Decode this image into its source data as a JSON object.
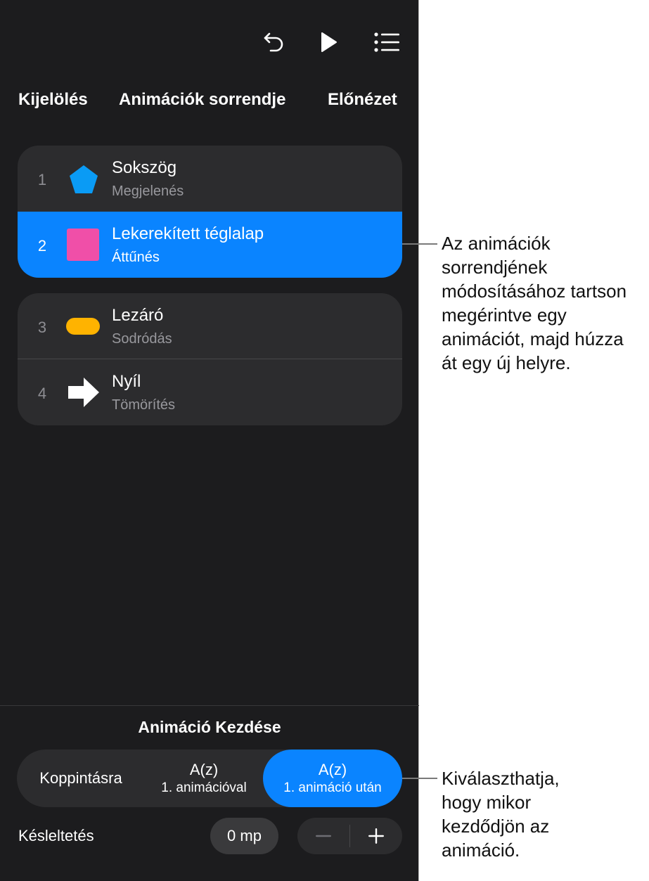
{
  "toolbar": {
    "undo_icon": "undo-arrow-icon",
    "play_icon": "play-icon",
    "list_icon": "list-icon"
  },
  "segments": {
    "selection": "Kijelölés",
    "order": "Animációk sorrendje",
    "preview": "Előnézet"
  },
  "animations": [
    {
      "number": "1",
      "title": "Sokszög",
      "effect": "Megjelenés",
      "shape": "pentagon",
      "color": "#0a9bf5"
    },
    {
      "number": "2",
      "title": "Lekerekített téglalap",
      "effect": "Áttűnés",
      "shape": "square",
      "color": "#f04fa8"
    },
    {
      "number": "3",
      "title": "Lezáró",
      "effect": "Sodródás",
      "shape": "capsule",
      "color": "#ffb300"
    },
    {
      "number": "4",
      "title": "Nyíl",
      "effect": "Tömörítés",
      "shape": "arrow",
      "color": "#ffffff"
    }
  ],
  "selected_index": 2,
  "start": {
    "title": "Animáció Kezdése",
    "options": [
      {
        "line1": "Koppintásra",
        "line2": ""
      },
      {
        "line1": "A(z)",
        "line2": "1. animációval"
      },
      {
        "line1": "A(z)",
        "line2": "1. animáció után"
      }
    ],
    "active_option": 3
  },
  "delay": {
    "label": "Késleltetés",
    "value": "0 mp",
    "minus": "−",
    "plus": "+"
  },
  "callouts": {
    "reorder": "Az animációk\nsorrendjének\nmódosításához tartson\nmegérintve egy\nanimációt, majd húzza\nát egy új helyre.",
    "start": "Kiválaszthatja,\nhogy mikor\nkezdődjön az\nanimáció."
  },
  "colors": {
    "accent": "#0a84ff",
    "panel_bg": "#1c1c1e",
    "group_bg": "#2c2c2e"
  }
}
